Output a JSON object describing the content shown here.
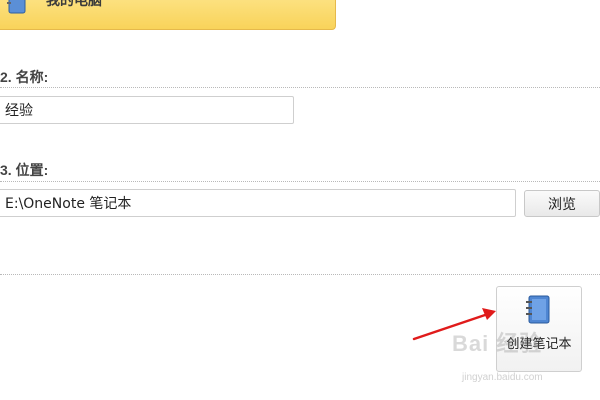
{
  "location_card": {
    "label": "我的电脑",
    "icon": "notebook-icon"
  },
  "name_section": {
    "title": "2. 名称:",
    "value": "经验"
  },
  "location_section": {
    "title": "3. 位置:",
    "value": "E:\\OneNote 笔记本",
    "browse_label": "浏览"
  },
  "create_button": {
    "label": "创建笔记本",
    "icon": "notebook-icon"
  },
  "watermark": {
    "text": "Bai 经验",
    "sub": "jingyan.baidu.com"
  },
  "colors": {
    "card": "#fbd96a",
    "arrow": "#e01b1b"
  }
}
